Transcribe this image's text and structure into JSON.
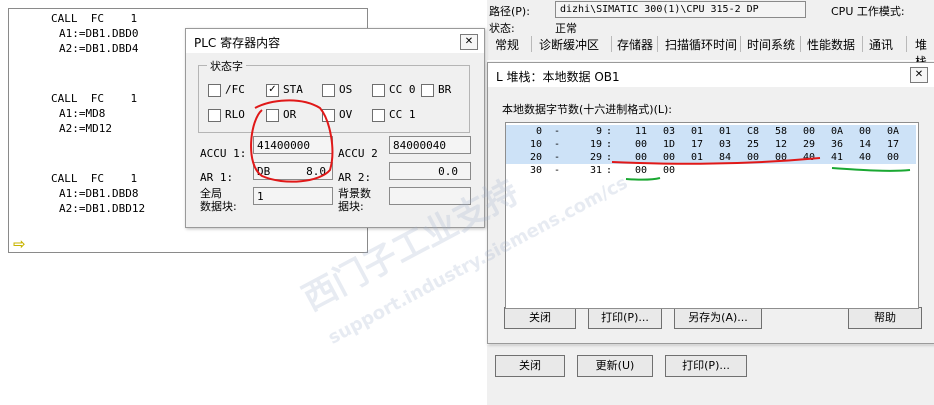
{
  "editor": {
    "lines": [
      "CALL  FC    1",
      "A1:=DB1.DBD0",
      "A2:=DB1.DBD4",
      "CALL  FC    1",
      "A1:=MD8",
      "A2:=MD12",
      "CALL  FC    1",
      "A1:=DB1.DBD8",
      "A2:=DB1.DBD12"
    ]
  },
  "module_info": {
    "path_label": "路径(P):",
    "path_value": "dizhi\\SIMATIC 300(1)\\CPU 315-2 DP",
    "cpu_mode_label": "CPU 工作模式:",
    "status_label": "状态:",
    "status_value": "正常",
    "tabs": [
      "常规",
      "诊断缓冲区",
      "存储器",
      "扫描循环时间",
      "时间系统",
      "性能数据",
      "通讯",
      "堆栈"
    ]
  },
  "plc_dialog": {
    "title": "PLC 寄存器内容",
    "status_group": "状态字",
    "flags": [
      {
        "label": "/FC",
        "checked": false
      },
      {
        "label": "STA",
        "checked": true
      },
      {
        "label": "OS",
        "checked": false
      },
      {
        "label": "CC 0",
        "checked": false
      },
      {
        "label": "BR",
        "checked": false
      },
      {
        "label": "RLO",
        "checked": false
      },
      {
        "label": "OR",
        "checked": false
      },
      {
        "label": "OV",
        "checked": false
      },
      {
        "label": "CC 1",
        "checked": false
      }
    ],
    "accu1_label": "ACCU 1:",
    "accu1_value": "41400000",
    "accu2_label": "ACCU 2",
    "accu2_value": "84000040",
    "ar1_label": "AR 1:",
    "ar1_area": "DB",
    "ar1_value": "8.0",
    "ar2_label": "AR 2:",
    "ar2_value": "0.0",
    "global_db_label": "全局\n数据块:",
    "global_db_value": "1",
    "inst_db_label": "背景数\n据块:",
    "inst_db_value": ""
  },
  "lstack_dialog": {
    "title": "L 堆栈：本地数据 OB1",
    "table_label": "本地数据字节数(十六进制格式)(L):",
    "rows": [
      {
        "from": "0",
        "to": "9",
        "bytes": [
          "11",
          "03",
          "01",
          "01",
          "C8",
          "58",
          "00",
          "0A",
          "00",
          "0A"
        ]
      },
      {
        "from": "10",
        "to": "19",
        "bytes": [
          "00",
          "1D",
          "17",
          "03",
          "25",
          "12",
          "29",
          "36",
          "14",
          "17"
        ]
      },
      {
        "from": "20",
        "to": "29",
        "bytes": [
          "00",
          "00",
          "01",
          "84",
          "00",
          "00",
          "40",
          "41",
          "40",
          "00"
        ]
      },
      {
        "from": "30",
        "to": "31",
        "bytes": [
          "00",
          "00"
        ]
      }
    ],
    "buttons": {
      "close": "关闭",
      "print": "打印(P)...",
      "save_as": "另存为(A)...",
      "help": "帮助"
    }
  },
  "bottom_bar": {
    "close": "关闭",
    "update": "更新(U)",
    "print": "打印(P)..."
  },
  "watermark": {
    "line1": "西门子工业支持",
    "line2": "support.industry.siemens.com/cs"
  }
}
